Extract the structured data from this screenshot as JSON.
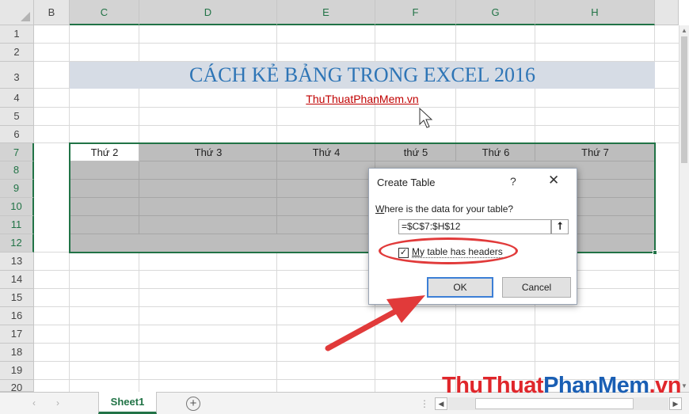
{
  "columns": [
    "B",
    "C",
    "D",
    "E",
    "F",
    "G",
    "H"
  ],
  "rows": [
    "1",
    "2",
    "3",
    "4",
    "5",
    "6",
    "7",
    "8",
    "9",
    "10",
    "11",
    "12",
    "13",
    "14",
    "15",
    "16",
    "17",
    "18",
    "19",
    "20"
  ],
  "sheet": {
    "title": "CÁCH KẺ BẢNG TRONG EXCEL 2016",
    "subtitle": "ThuThuatPhanMem.vn"
  },
  "table": {
    "headers": [
      "Thứ 2",
      "Thứ 3",
      "Thứ 4",
      "thứ 5",
      "Thứ 6",
      "Thứ 7"
    ]
  },
  "dialog": {
    "title": "Create Table",
    "help_label": "?",
    "close_label": "✕",
    "question_prefix": "W",
    "question_rest": "here is the data for your table?",
    "range_value": "=$C$7:$H$12",
    "collapse_label": "⭡",
    "checkbox_checked": true,
    "checkbox_mark": "✓",
    "checkbox_label_prefix": "M",
    "checkbox_label_rest": "y table has headers",
    "ok_label": "OK",
    "cancel_label": "Cancel"
  },
  "tabs": {
    "sheet1": "Sheet1",
    "add_label": "+",
    "nav_prev": "‹",
    "nav_next": "›",
    "split_dots": "⋮",
    "hscroll_left": "◀",
    "hscroll_right": "▶"
  },
  "scroll": {
    "up": "▲",
    "down": "▼"
  },
  "watermark": {
    "part1": "ThuThuat",
    "part2": "PhanMem",
    "part3": ".vn"
  },
  "colors": {
    "excel_green": "#217346",
    "title_band": "#d6dce5",
    "title_text": "#2e75b6",
    "subtitle_text": "#c00000",
    "table_fill": "#bdbdbd",
    "annotation_red": "#e13a3a"
  }
}
